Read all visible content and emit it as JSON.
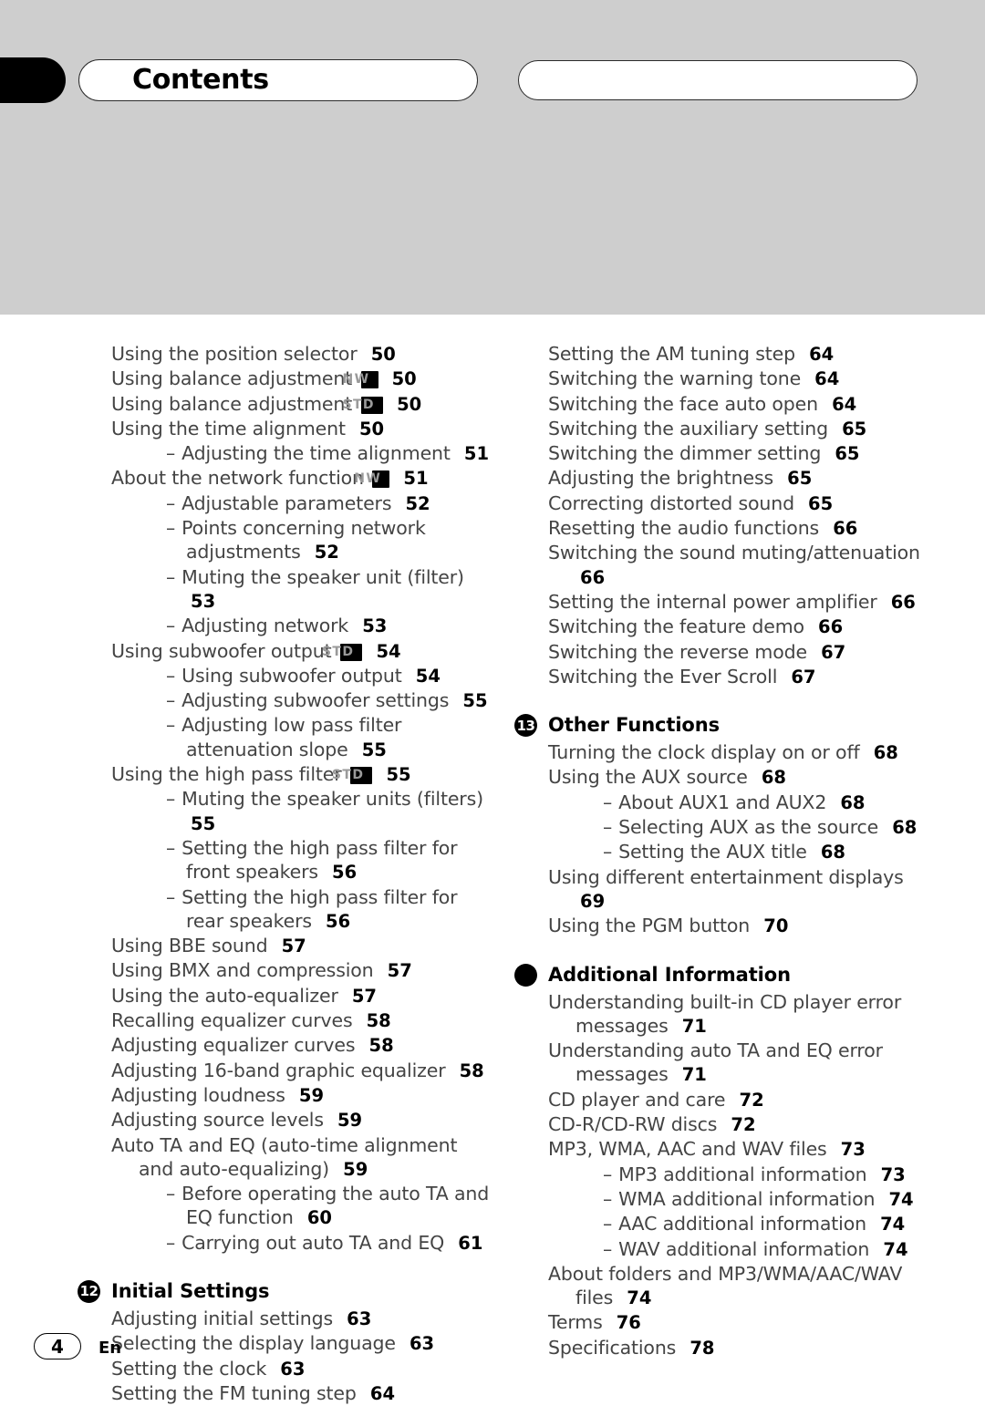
{
  "header": {
    "title": "Contents",
    "right_pill_label": ""
  },
  "colors": {
    "header_band": "#cecece",
    "badge_bg": "#000000",
    "badge_text": "#9a9a9a",
    "body_text": "#444444",
    "page_number": "#000000"
  },
  "left_column": [
    {
      "level": 0,
      "text": "Using the position selector",
      "page": "50"
    },
    {
      "level": 0,
      "text": "Using balance adjustment",
      "badge": "NW",
      "page": "50"
    },
    {
      "level": 0,
      "text": "Using balance adjustment",
      "badge": "STD",
      "page": "50"
    },
    {
      "level": 0,
      "text": "Using the time alignment",
      "page": "50"
    },
    {
      "level": 1,
      "text": "Adjusting the time alignment",
      "page": "51"
    },
    {
      "level": 0,
      "text": "About the network function",
      "badge": "NW",
      "page": "51"
    },
    {
      "level": 1,
      "text": "Adjustable parameters",
      "page": "52"
    },
    {
      "level": 1,
      "text": "Points concerning network adjustments",
      "page": "52"
    },
    {
      "level": 1,
      "text": "Muting the speaker unit (filter)",
      "page": "53"
    },
    {
      "level": 1,
      "text": "Adjusting network",
      "page": "53"
    },
    {
      "level": 0,
      "text": "Using subwoofer output",
      "badge": "STD",
      "page": "54"
    },
    {
      "level": 1,
      "text": "Using subwoofer output",
      "page": "54"
    },
    {
      "level": 1,
      "text": "Adjusting subwoofer settings",
      "page": "55"
    },
    {
      "level": 1,
      "text": "Adjusting low pass filter attenuation slope",
      "page": "55"
    },
    {
      "level": 0,
      "text": "Using the high pass filter",
      "badge": "STD",
      "page": "55"
    },
    {
      "level": 1,
      "text": "Muting the speaker units (filters)",
      "page": "55"
    },
    {
      "level": 1,
      "text": "Setting the high pass filter for front speakers",
      "page": "56"
    },
    {
      "level": 1,
      "text": "Setting the high pass filter for rear speakers",
      "page": "56"
    },
    {
      "level": 0,
      "text": "Using BBE sound",
      "page": "57"
    },
    {
      "level": 0,
      "text": "Using BMX and compression",
      "page": "57"
    },
    {
      "level": 0,
      "text": "Using the auto-equalizer",
      "page": "57"
    },
    {
      "level": 0,
      "text": "Recalling equalizer curves",
      "page": "58"
    },
    {
      "level": 0,
      "text": "Adjusting equalizer curves",
      "page": "58"
    },
    {
      "level": 0,
      "text": "Adjusting 16-band graphic equalizer",
      "page": "58"
    },
    {
      "level": 0,
      "text": "Adjusting loudness",
      "page": "59"
    },
    {
      "level": 0,
      "text": "Adjusting source levels",
      "page": "59"
    },
    {
      "level": 0,
      "text": "Auto TA and EQ (auto-time alignment and auto-equalizing)",
      "page": "59"
    },
    {
      "level": 1,
      "text": "Before operating the auto TA and EQ function",
      "page": "60"
    },
    {
      "level": 1,
      "text": "Carrying out auto TA and EQ",
      "page": "61"
    },
    {
      "level": "section",
      "marker": "12",
      "text": "Initial Settings"
    },
    {
      "level": 0,
      "text": "Adjusting initial settings",
      "page": "63"
    },
    {
      "level": 0,
      "text": "Selecting the display language",
      "page": "63"
    },
    {
      "level": 0,
      "text": "Setting the clock",
      "page": "63"
    },
    {
      "level": 0,
      "text": "Setting the FM tuning step",
      "page": "64"
    }
  ],
  "right_column": [
    {
      "level": 0,
      "text": "Setting the AM tuning step",
      "page": "64"
    },
    {
      "level": 0,
      "text": "Switching the warning tone",
      "page": "64"
    },
    {
      "level": 0,
      "text": "Switching the face auto open",
      "page": "64"
    },
    {
      "level": 0,
      "text": "Switching the auxiliary setting",
      "page": "65"
    },
    {
      "level": 0,
      "text": "Switching the dimmer setting",
      "page": "65"
    },
    {
      "level": 0,
      "text": "Adjusting the brightness",
      "page": "65"
    },
    {
      "level": 0,
      "text": "Correcting distorted sound",
      "page": "65"
    },
    {
      "level": 0,
      "text": "Resetting the audio functions",
      "page": "66"
    },
    {
      "level": 0,
      "text": "Switching the sound muting/attenuation",
      "page": "66"
    },
    {
      "level": 0,
      "text": "Setting the internal power amplifier",
      "page": "66"
    },
    {
      "level": 0,
      "text": "Switching the feature demo",
      "page": "66"
    },
    {
      "level": 0,
      "text": "Switching the reverse mode",
      "page": "67"
    },
    {
      "level": 0,
      "text": "Switching the Ever Scroll",
      "page": "67"
    },
    {
      "level": "section",
      "marker": "13",
      "text": "Other Functions"
    },
    {
      "level": 0,
      "text": "Turning the clock display on or off",
      "page": "68"
    },
    {
      "level": 0,
      "text": "Using the AUX source",
      "page": "68"
    },
    {
      "level": 1,
      "text": "About AUX1 and AUX2",
      "page": "68"
    },
    {
      "level": 1,
      "text": "Selecting AUX as the source",
      "page": "68"
    },
    {
      "level": 1,
      "text": "Setting the AUX title",
      "page": "68"
    },
    {
      "level": 0,
      "text": "Using different entertainment displays",
      "page": "69"
    },
    {
      "level": 0,
      "text": "Using the PGM button",
      "page": "70"
    },
    {
      "level": "section",
      "marker": "",
      "text": "Additional Information"
    },
    {
      "level": 0,
      "text": "Understanding built-in CD player error messages",
      "page": "71"
    },
    {
      "level": 0,
      "text": "Understanding auto TA and EQ error messages",
      "page": "71"
    },
    {
      "level": 0,
      "text": "CD player and care",
      "page": "72"
    },
    {
      "level": 0,
      "text": "CD-R/CD-RW discs",
      "page": "72"
    },
    {
      "level": 0,
      "text": "MP3, WMA, AAC and WAV files",
      "page": "73"
    },
    {
      "level": 1,
      "text": "MP3 additional information",
      "page": "73"
    },
    {
      "level": 1,
      "text": "WMA additional information",
      "page": "74"
    },
    {
      "level": 1,
      "text": "AAC additional information",
      "page": "74"
    },
    {
      "level": 1,
      "text": "WAV additional information",
      "page": "74"
    },
    {
      "level": 0,
      "text": "About folders and MP3/WMA/AAC/WAV files",
      "page": "74"
    },
    {
      "level": 0,
      "text": "Terms",
      "page": "76"
    },
    {
      "level": 0,
      "text": "Specifications",
      "page": "78"
    }
  ],
  "footer": {
    "page_number": "4",
    "language": "En"
  }
}
